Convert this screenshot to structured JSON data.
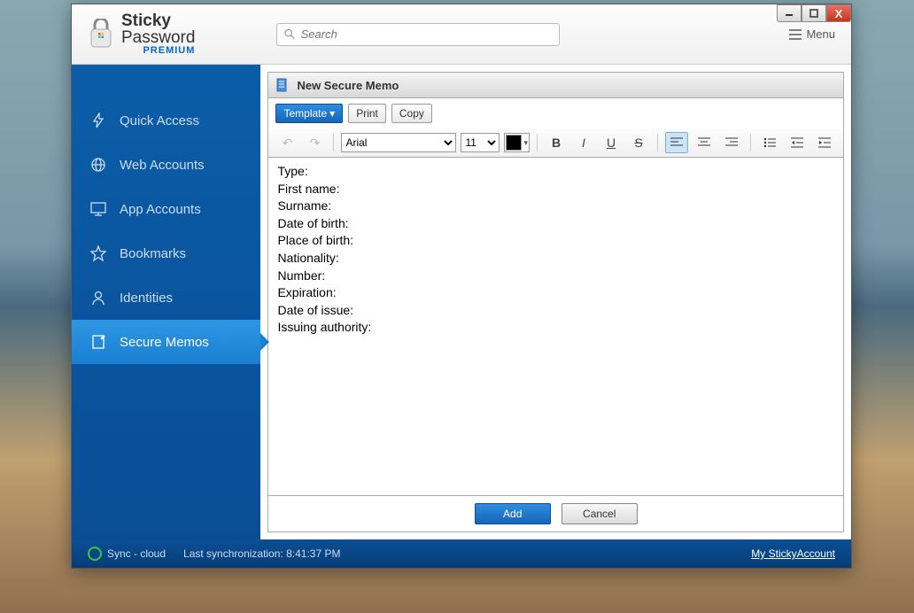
{
  "app": {
    "title_line1": "Sticky",
    "title_line2": "Password",
    "title_line3": "PREMIUM"
  },
  "header": {
    "search_placeholder": "Search",
    "menu_label": "Menu"
  },
  "sidebar": {
    "items": [
      {
        "label": "Quick Access"
      },
      {
        "label": "Web Accounts"
      },
      {
        "label": "App Accounts"
      },
      {
        "label": "Bookmarks"
      },
      {
        "label": "Identities"
      },
      {
        "label": "Secure Memos"
      }
    ]
  },
  "content": {
    "header_title": "New Secure Memo",
    "actions": {
      "template": "Template",
      "print": "Print",
      "copy": "Copy"
    },
    "format": {
      "font": "Arial",
      "size": "11"
    },
    "memo_fields": [
      "Type:",
      "First name:",
      "Surname:",
      "Date of birth:",
      "Place of birth:",
      "Nationality:",
      "Number:",
      "Expiration:",
      "Date of issue:",
      "Issuing authority:"
    ],
    "buttons": {
      "add": "Add",
      "cancel": "Cancel"
    }
  },
  "footer": {
    "sync_label": "Sync - cloud",
    "last_sync": "Last synchronization: 8:41:37 PM",
    "account_link": "My StickyAccount"
  }
}
